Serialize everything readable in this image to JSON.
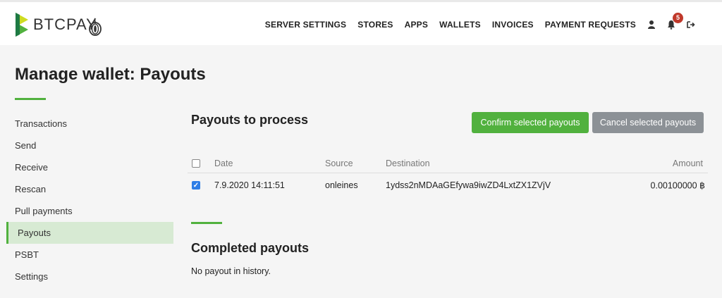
{
  "app": {
    "brand_name": "BTCPAY",
    "brand_color": "#51b13e",
    "icons": [
      "btcpay-logo-icon",
      "tor-onion-icon",
      "user-icon",
      "bell-icon",
      "logout-icon"
    ]
  },
  "nav": {
    "items": [
      "SERVER SETTINGS",
      "STORES",
      "APPS",
      "WALLETS",
      "INVOICES",
      "PAYMENT REQUESTS"
    ],
    "notifications_count": "5"
  },
  "page": {
    "title": "Manage wallet: Payouts"
  },
  "sidebar": {
    "items": [
      "Transactions",
      "Send",
      "Receive",
      "Rescan",
      "Pull payments",
      "Payouts",
      "PSBT",
      "Settings"
    ],
    "active": "Payouts"
  },
  "to_process": {
    "title": "Payouts to process",
    "confirm_label": "Confirm selected payouts",
    "cancel_label": "Cancel selected payouts",
    "headers": {
      "date": "Date",
      "source": "Source",
      "destination": "Destination",
      "amount": "Amount"
    },
    "rows": [
      {
        "checked": true,
        "date": "7.9.2020 14:11:51",
        "source": "onleines",
        "destination": "1ydss2nMDAaGEfywa9iwZD4LxtZX1ZVjV",
        "amount": "0.00100000 ฿"
      }
    ]
  },
  "completed": {
    "title": "Completed payouts",
    "empty_text": "No payout in history."
  }
}
